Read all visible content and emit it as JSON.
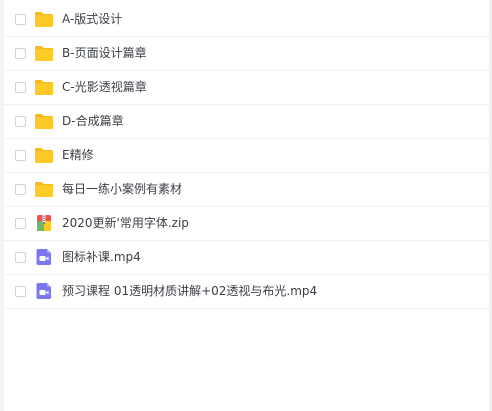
{
  "files": [
    {
      "name": "A-版式设计",
      "type": "folder-icon"
    },
    {
      "name": "B-页面设计篇章",
      "type": "folder-icon"
    },
    {
      "name": "C-光影透视篇章",
      "type": "folder-icon"
    },
    {
      "name": "D-合成篇章",
      "type": "folder-icon"
    },
    {
      "name": "E精修",
      "type": "folder-icon"
    },
    {
      "name": "每日一练小案例有素材",
      "type": "folder-icon"
    },
    {
      "name": "2020更新'常用字体.zip",
      "type": "zip-icon"
    },
    {
      "name": "图标补课.mp4",
      "type": "video-icon"
    },
    {
      "name": "预习课程 01透明材质讲解+02透视与布光.mp4",
      "type": "video-icon"
    }
  ],
  "colors": {
    "folder": "#ffca28",
    "folder_tab": "#f5b81b",
    "video": "#7b77f2",
    "text": "#3b3f46"
  }
}
